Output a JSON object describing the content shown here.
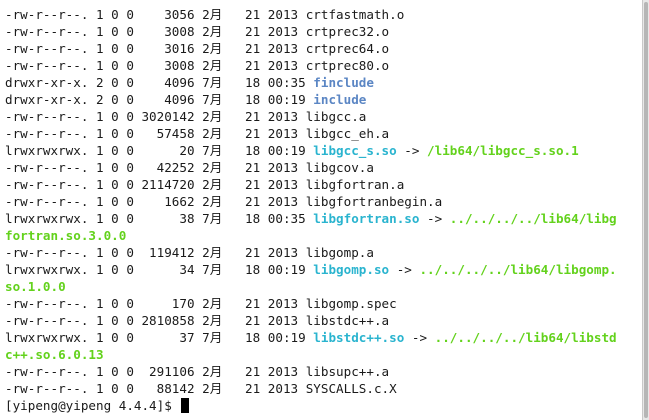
{
  "terminal": {
    "lines": [
      {
        "meta": "-rw-r--r--. 1 0 0    3056 2月   21 2013 ",
        "name": "crtfastmath.o",
        "name_type": "file"
      },
      {
        "meta": "-rw-r--r--. 1 0 0    3008 2月   21 2013 ",
        "name": "crtprec32.o",
        "name_type": "file"
      },
      {
        "meta": "-rw-r--r--. 1 0 0    3016 2月   21 2013 ",
        "name": "crtprec64.o",
        "name_type": "file"
      },
      {
        "meta": "-rw-r--r--. 1 0 0    3008 2月   21 2013 ",
        "name": "crtprec80.o",
        "name_type": "file"
      },
      {
        "meta": "drwxr-xr-x. 2 0 0    4096 7月   18 00:35 ",
        "name": "finclude",
        "name_type": "dir"
      },
      {
        "meta": "drwxr-xr-x. 2 0 0    4096 7月   18 00:19 ",
        "name": "include",
        "name_type": "dir"
      },
      {
        "meta": "-rw-r--r--. 1 0 0 3020142 2月   21 2013 ",
        "name": "libgcc.a",
        "name_type": "file"
      },
      {
        "meta": "-rw-r--r--. 1 0 0   57458 2月   21 2013 ",
        "name": "libgcc_eh.a",
        "name_type": "file"
      },
      {
        "meta": "lrwxrwxrwx. 1 0 0      20 7月   18 00:19 ",
        "name": "libgcc_s.so",
        "name_type": "link",
        "arrow": " -> ",
        "target": "/lib64/libgcc_s.so.1"
      },
      {
        "meta": "-rw-r--r--. 1 0 0   42252 2月   21 2013 ",
        "name": "libgcov.a",
        "name_type": "file"
      },
      {
        "meta": "-rw-r--r--. 1 0 0 2114720 2月   21 2013 ",
        "name": "libgfortran.a",
        "name_type": "file"
      },
      {
        "meta": "-rw-r--r--. 1 0 0    1662 2月   21 2013 ",
        "name": "libgfortranbegin.a",
        "name_type": "file"
      },
      {
        "meta": "lrwxrwxrwx. 1 0 0      38 7月   18 00:35 ",
        "name": "libgfortran.so",
        "name_type": "link",
        "arrow": " -> ",
        "target": "../../../../lib64/libg",
        "target_cont": "fortran.so.3.0.0"
      },
      {
        "meta": "-rw-r--r--. 1 0 0  119412 2月   21 2013 ",
        "name": "libgomp.a",
        "name_type": "file"
      },
      {
        "meta": "lrwxrwxrwx. 1 0 0      34 7月   18 00:19 ",
        "name": "libgomp.so",
        "name_type": "link",
        "arrow": " -> ",
        "target": "../../../../lib64/libgomp.",
        "target_cont": "so.1.0.0"
      },
      {
        "meta": "-rw-r--r--. 1 0 0     170 2月   21 2013 ",
        "name": "libgomp.spec",
        "name_type": "file"
      },
      {
        "meta": "-rw-r--r--. 1 0 0 2810858 2月   21 2013 ",
        "name": "libstdc++.a",
        "name_type": "file"
      },
      {
        "meta": "lrwxrwxrwx. 1 0 0      37 7月   18 00:19 ",
        "name": "libstdc++.so",
        "name_type": "link",
        "arrow": " -> ",
        "target": "../../../../lib64/libstd",
        "target_cont": "c++.so.6.0.13"
      },
      {
        "meta": "-rw-r--r--. 1 0 0  291106 2月   21 2013 ",
        "name": "libsupc++.a",
        "name_type": "file"
      },
      {
        "meta": "-rw-r--r--. 1 0 0   88142 2月   21 2013 ",
        "name": "SYSCALLS.c.X",
        "name_type": "file"
      }
    ],
    "prompt": "[yipeng@yipeng 4.4.4]$ "
  },
  "colors": {
    "background": "#ffffff",
    "text": "#1a1a1a",
    "directory": "#5b86c4",
    "symlink": "#2ab4cf",
    "link_target": "#63d21c"
  }
}
